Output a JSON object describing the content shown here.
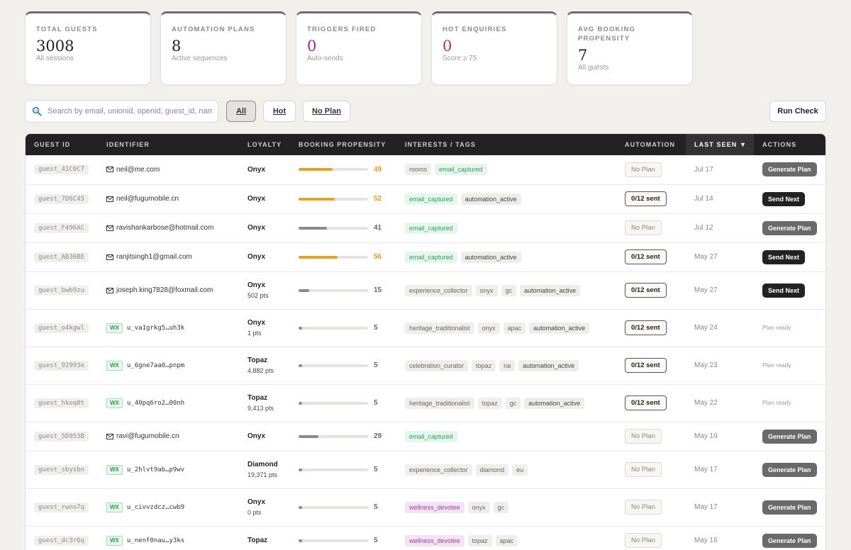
{
  "stats": [
    {
      "label": "TOTAL GUESTS",
      "value": "3008",
      "sub": "All sessions",
      "tone": ""
    },
    {
      "label": "AUTOMATION PLANS",
      "value": "8",
      "sub": "Active sequences",
      "tone": ""
    },
    {
      "label": "TRIGGERS FIRED",
      "value": "0",
      "sub": "Auto-sends",
      "tone": "purple"
    },
    {
      "label": "HOT ENQUIRIES",
      "value": "0",
      "sub": "Score ≥ 75",
      "tone": "red"
    },
    {
      "label": "AVG BOOKING PROPENSITY",
      "value": "7",
      "sub": "All guests",
      "tone": ""
    }
  ],
  "search": {
    "placeholder": "Search by email, unionid, openid, guest_id, nam"
  },
  "filters": [
    {
      "label": "All",
      "active": true
    },
    {
      "label": "Hot",
      "active": false
    },
    {
      "label": "No Plan",
      "active": false
    }
  ],
  "run_check_label": "Run Check",
  "table": {
    "headers": [
      "GUEST ID",
      "IDENTIFIER",
      "LOYALTY",
      "BOOKING PROPENSITY",
      "INTERESTS / TAGS",
      "AUTOMATION",
      "LAST SEEN ▼",
      "ACTIONS"
    ],
    "rows": [
      {
        "id": "guest_41C6C7",
        "ident_type": "mail",
        "ident": "neil@me.com",
        "tier": "Onyx",
        "pts": "",
        "prop": 49,
        "prop_color": "orange",
        "tags": [
          {
            "t": "rooms",
            "s": ""
          },
          {
            "t": "email_captured",
            "s": "green"
          }
        ],
        "auto": "No Plan",
        "auto_kind": "none",
        "seen": "Jul 17",
        "action": "Generate Plan",
        "action_kind": "gen"
      },
      {
        "id": "guest_7D6C45",
        "ident_type": "mail",
        "ident": "neil@fugumobile.cn",
        "tier": "Onyx",
        "pts": "",
        "prop": 52,
        "prop_color": "orange",
        "tags": [
          {
            "t": "email_captured",
            "s": "green"
          },
          {
            "t": "automation_active",
            "s": "dark"
          }
        ],
        "auto": "0/12 sent",
        "auto_kind": "sent",
        "seen": "Jul 14",
        "action": "Send Next",
        "action_kind": "send"
      },
      {
        "id": "guest_F496AC",
        "ident_type": "mail",
        "ident": "ravishankarbose@hotmail.com",
        "tier": "Onyx",
        "pts": "",
        "prop": 41,
        "prop_color": "gray",
        "tags": [
          {
            "t": "email_captured",
            "s": "green"
          }
        ],
        "auto": "No Plan",
        "auto_kind": "none",
        "seen": "Jul 12",
        "action": "Generate Plan",
        "action_kind": "gen"
      },
      {
        "id": "guest_AB36BE",
        "ident_type": "mail",
        "ident": "ranjitsingh1@gmail.com",
        "tier": "Onyx",
        "pts": "",
        "prop": 56,
        "prop_color": "orange",
        "tags": [
          {
            "t": "email_captured",
            "s": "green"
          },
          {
            "t": "automation_active",
            "s": "dark"
          }
        ],
        "auto": "0/12 sent",
        "auto_kind": "sent",
        "seen": "May 27",
        "action": "Send Next",
        "action_kind": "send"
      },
      {
        "id": "guest_bwb9zu",
        "ident_type": "mail",
        "ident": "joseph.king7828@foxmail.com",
        "tier": "Onyx",
        "pts": "502 pts",
        "prop": 15,
        "prop_color": "gray",
        "tags": [
          {
            "t": "experience_collector",
            "s": ""
          },
          {
            "t": "onyx",
            "s": ""
          },
          {
            "t": "gc",
            "s": ""
          },
          {
            "t": "automation_active",
            "s": "dark"
          }
        ],
        "auto": "0/12 sent",
        "auto_kind": "sent",
        "seen": "May 27",
        "action": "Send Next",
        "action_kind": "send"
      },
      {
        "id": "guest_o4kgwl",
        "ident_type": "wx",
        "ident": "u_va1grkg5…uh3k",
        "tier": "Onyx",
        "pts": "1 pts",
        "prop": 5,
        "prop_color": "gray",
        "tags": [
          {
            "t": "heritage_traditionalist",
            "s": ""
          },
          {
            "t": "onyx",
            "s": ""
          },
          {
            "t": "apac",
            "s": ""
          },
          {
            "t": "automation_active",
            "s": "dark"
          }
        ],
        "auto": "0/12 sent",
        "auto_kind": "sent",
        "seen": "May 24",
        "action": "Plan ready",
        "action_kind": "ready"
      },
      {
        "id": "guest_92993e",
        "ident_type": "wx",
        "ident": "u_6gne7aa0…pnpm",
        "tier": "Topaz",
        "pts": "4,882 pts",
        "prop": 5,
        "prop_color": "gray",
        "tags": [
          {
            "t": "celebration_curator",
            "s": ""
          },
          {
            "t": "topaz",
            "s": ""
          },
          {
            "t": "na",
            "s": ""
          },
          {
            "t": "automation_active",
            "s": "dark"
          }
        ],
        "auto": "0/12 sent",
        "auto_kind": "sent",
        "seen": "May 23",
        "action": "Plan ready",
        "action_kind": "ready"
      },
      {
        "id": "guest_hkoq8t",
        "ident_type": "wx",
        "ident": "u_40pq6ro2…00nh",
        "tier": "Topaz",
        "pts": "9,413 pts",
        "prop": 5,
        "prop_color": "gray",
        "tags": [
          {
            "t": "heritage_traditionalist",
            "s": ""
          },
          {
            "t": "topaz",
            "s": ""
          },
          {
            "t": "gc",
            "s": ""
          },
          {
            "t": "automation_active",
            "s": "dark"
          }
        ],
        "auto": "0/12 sent",
        "auto_kind": "sent",
        "seen": "May 22",
        "action": "Plan ready",
        "action_kind": "ready"
      },
      {
        "id": "guest_5D953B",
        "ident_type": "mail",
        "ident": "ravi@fugumobile.cn",
        "tier": "Onyx",
        "pts": "",
        "prop": 29,
        "prop_color": "gray",
        "tags": [
          {
            "t": "email_captured",
            "s": "green"
          }
        ],
        "auto": "No Plan",
        "auto_kind": "none",
        "seen": "May 19",
        "action": "Generate Plan",
        "action_kind": "gen"
      },
      {
        "id": "guest_sbysbn",
        "ident_type": "wx",
        "ident": "u_2hlvt9ab…p9wv",
        "tier": "Diamond",
        "pts": "19,371 pts",
        "prop": 5,
        "prop_color": "gray",
        "tags": [
          {
            "t": "experience_collector",
            "s": ""
          },
          {
            "t": "diamond",
            "s": ""
          },
          {
            "t": "eu",
            "s": ""
          }
        ],
        "auto": "No Plan",
        "auto_kind": "none",
        "seen": "May 17",
        "action": "Generate Plan",
        "action_kind": "gen"
      },
      {
        "id": "guest_rwno7q",
        "ident_type": "wx",
        "ident": "u_civvzdcz…cwb9",
        "tier": "Onyx",
        "pts": "0 pts",
        "prop": 5,
        "prop_color": "gray",
        "tags": [
          {
            "t": "wellness_devotee",
            "s": "purple"
          },
          {
            "t": "onyx",
            "s": ""
          },
          {
            "t": "gc",
            "s": ""
          }
        ],
        "auto": "No Plan",
        "auto_kind": "none",
        "seen": "May 17",
        "action": "Generate Plan",
        "action_kind": "gen"
      },
      {
        "id": "guest_dc3r6q",
        "ident_type": "wx",
        "ident": "u_nenf0nau…y3ks",
        "tier": "Topaz",
        "pts": "",
        "prop": 5,
        "prop_color": "gray",
        "tags": [
          {
            "t": "wellness_devotee",
            "s": "purple"
          },
          {
            "t": "topaz",
            "s": ""
          },
          {
            "t": "apac",
            "s": ""
          }
        ],
        "auto": "No Plan",
        "auto_kind": "none",
        "seen": "May 16",
        "action": "Generate Plan",
        "action_kind": "gen"
      }
    ]
  }
}
